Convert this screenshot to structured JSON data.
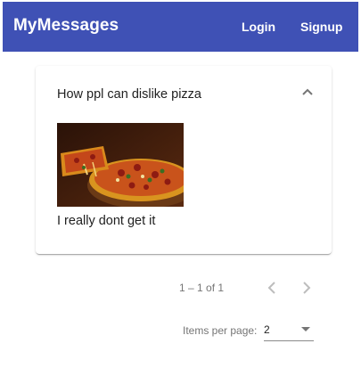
{
  "toolbar": {
    "app_title": "MyMessages",
    "login_label": "Login",
    "signup_label": "Signup",
    "color": "#3f51b5"
  },
  "post": {
    "title": "How ppl can dislike pizza",
    "expanded": true,
    "image": "pizza-photo",
    "body": "I really dont get it"
  },
  "paginator": {
    "range_label": "1 – 1 of 1",
    "prev_enabled": false,
    "next_enabled": false,
    "items_per_page_label": "Items per page:",
    "items_per_page_value": "2"
  }
}
